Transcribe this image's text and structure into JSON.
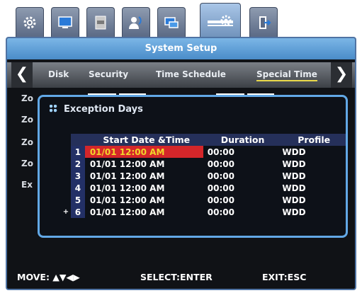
{
  "top_tabs": [
    {
      "name": "gear-icon"
    },
    {
      "name": "monitor-icon"
    },
    {
      "name": "hdd-icon"
    },
    {
      "name": "user-icon"
    },
    {
      "name": "network-icon"
    },
    {
      "name": "system-icon",
      "active": true
    },
    {
      "name": "exit-icon"
    }
  ],
  "header": {
    "title": "System Setup"
  },
  "subnav": {
    "tabs": [
      "Disk",
      "Security",
      "Time Schedule",
      "Special Time"
    ],
    "active": "Special Time"
  },
  "background_labels": [
    "Zo",
    "Zo",
    "Zo",
    "Zo",
    "Ex"
  ],
  "dialog": {
    "title": "Exception Days",
    "columns": [
      "Start Date &Time",
      "Duration",
      "Profile"
    ],
    "rows": [
      {
        "no": "1",
        "start": "01/01 12:00 AM",
        "duration": "00:00",
        "profile": "WDD",
        "selected": true
      },
      {
        "no": "2",
        "start": "01/01 12:00 AM",
        "duration": "00:00",
        "profile": "WDD"
      },
      {
        "no": "3",
        "start": "01/01 12:00 AM",
        "duration": "00:00",
        "profile": "WDD"
      },
      {
        "no": "4",
        "start": "01/01 12:00 AM",
        "duration": "00:00",
        "profile": "WDD"
      },
      {
        "no": "5",
        "start": "01/01 12:00 AM",
        "duration": "00:00",
        "profile": "WDD"
      },
      {
        "no": "6",
        "start": "01/01 12:00 AM",
        "duration": "00:00",
        "profile": "WDD",
        "marker": "+"
      }
    ]
  },
  "footer": {
    "move": "MOVE: ▲▼◀▶",
    "select": "SELECT:ENTER",
    "exit": "EXIT:ESC"
  },
  "colors": {
    "accent": "#62a8e6",
    "title_bar": "#5a9ad4",
    "selected_row_bg": "#d4262a",
    "selected_row_text": "#f2d62a",
    "active_underline": "#e8d84a"
  }
}
